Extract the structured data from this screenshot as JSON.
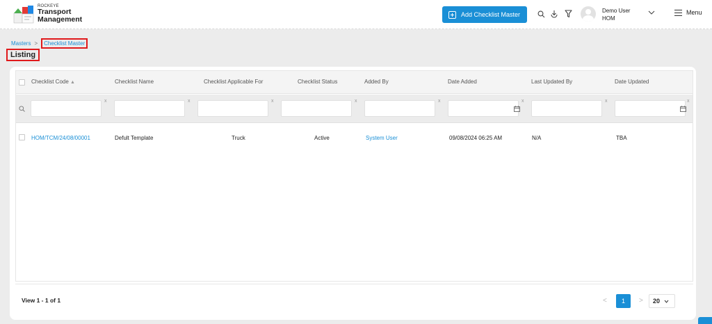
{
  "brand": {
    "company": "ROCKEYE",
    "line1": "Transport",
    "line2": "Management"
  },
  "header": {
    "add_button": "Add Checklist Master",
    "user_name": "Demo User",
    "user_role": "HOM",
    "menu_label": "Menu",
    "icons": [
      "search-icon",
      "download-icon",
      "filter-icon",
      "chevron-down-icon",
      "hamburger-icon"
    ]
  },
  "breadcrumb": {
    "parent": "Masters",
    "separator": ">",
    "current": "Checklist Master"
  },
  "page_title": "Listing",
  "table": {
    "columns": [
      "Checklist Code",
      "Checklist Name",
      "Checklist Applicable For",
      "Checklist Status",
      "Added By",
      "Date Added",
      "Last Updated By",
      "Date Updated"
    ],
    "filter_clear": "x",
    "rows": [
      {
        "code": "HOM/TCM/24/08/00001",
        "name": "Defult Template",
        "applicable_for": "Truck",
        "status": "Active",
        "added_by": "System User",
        "date_added": "09/08/2024 06:25 AM",
        "last_updated_by": "N/A",
        "date_updated": "TBA"
      }
    ]
  },
  "pagination": {
    "view_info": "View 1 - 1 of 1",
    "prev": "<",
    "current_page": "1",
    "next": ">",
    "page_size": "20"
  },
  "colors": {
    "accent": "#1a8fd6",
    "highlight": "#e0191b"
  }
}
